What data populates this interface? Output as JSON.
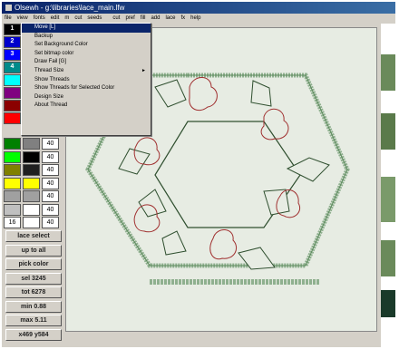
{
  "window": {
    "title": "Olsewh - g:\\libraries\\lace_main.lfw"
  },
  "menubar": [
    "file",
    "view",
    "fonts",
    "edit",
    "m",
    "cut",
    "seeds",
    "",
    "cut",
    "pref",
    "fill",
    "add",
    "lace",
    "fx",
    "help"
  ],
  "context_menu": {
    "items": [
      {
        "label": "Move [L]",
        "highlighted": true,
        "has_submenu": false
      },
      {
        "label": "Backup",
        "highlighted": false,
        "has_submenu": false
      },
      {
        "label": "Set Background Color",
        "highlighted": false,
        "has_submenu": false
      },
      {
        "label": "Set bitmap color",
        "highlighted": false,
        "has_submenu": false
      },
      {
        "label": "Draw Fail [G]",
        "highlighted": false,
        "has_submenu": false
      },
      {
        "label": "Thread Size",
        "highlighted": false,
        "has_submenu": true
      },
      {
        "label": "Show Threads",
        "highlighted": false,
        "has_submenu": false
      },
      {
        "label": "Show Threads for Selected Color",
        "highlighted": false,
        "has_submenu": false
      },
      {
        "label": "Design Size",
        "highlighted": false,
        "has_submenu": false
      },
      {
        "label": "About Thread",
        "highlighted": false,
        "has_submenu": false
      }
    ],
    "submenu_arrow": "►"
  },
  "palette": {
    "top_swatches": [
      {
        "color": "#000000",
        "badge": "1"
      },
      {
        "color": "#0000cc",
        "badge": "2"
      },
      {
        "color": "#0000ff",
        "badge": "3"
      },
      {
        "color": "#008b8b",
        "badge": "4"
      },
      {
        "color": "#00ffff",
        "badge": ""
      },
      {
        "color": "#800080",
        "badge": ""
      },
      {
        "color": "#8b0000",
        "badge": ""
      },
      {
        "color": "#ff0000",
        "badge": ""
      }
    ],
    "rows": [
      {
        "left": "#008000",
        "mid": "#808080",
        "num": "40"
      },
      {
        "left": "#00ff00",
        "mid": "#000000",
        "num": "40"
      },
      {
        "left": "#808000",
        "mid": "#202020",
        "num": "40"
      },
      {
        "left": "#ffff00",
        "mid": "#ffff00",
        "num": "40"
      },
      {
        "left": "#a0a0a0",
        "mid": "#a0a0a0",
        "num": "40"
      },
      {
        "left": "#c0c0c0",
        "mid": "#ffffff",
        "num": "40"
      },
      {
        "left_text": "16",
        "mid": "#ffffff",
        "num": "40"
      }
    ]
  },
  "sidebar_buttons": [
    {
      "name": "lace-select-button",
      "label": "lace select"
    },
    {
      "name": "up-to-all-button",
      "label": "up to all"
    },
    {
      "name": "pick-color-button",
      "label": "pick color"
    },
    {
      "name": "sel-count-button",
      "label": "sel 3245"
    },
    {
      "name": "tot-count-button",
      "label": "tot 6278"
    },
    {
      "name": "min-value-button",
      "label": "min 0.88"
    },
    {
      "name": "max-value-button",
      "label": "max 5.11"
    },
    {
      "name": "size-button",
      "label": "x469 y584"
    }
  ]
}
